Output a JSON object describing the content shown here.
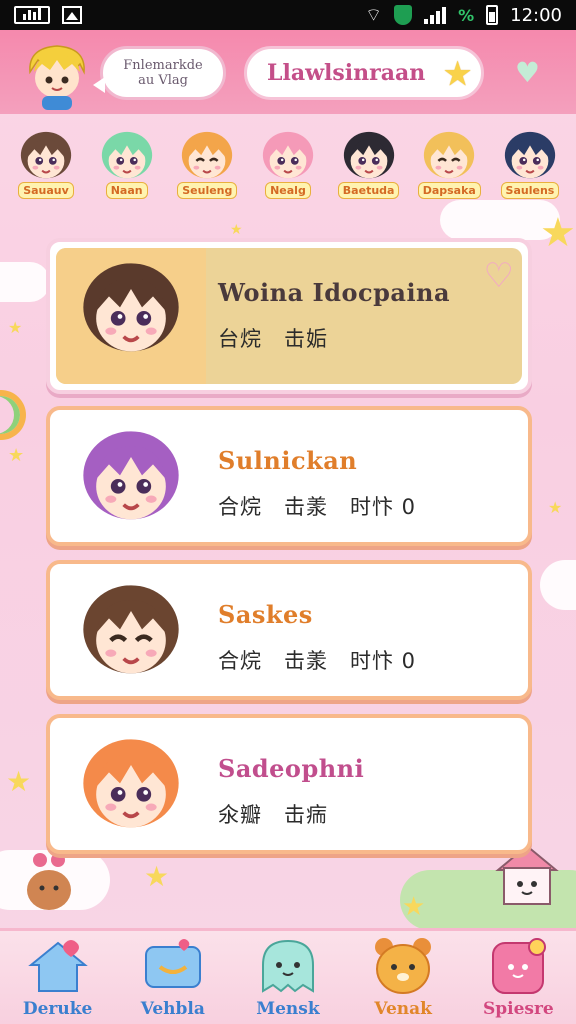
{
  "status_bar": {
    "time": "12:00",
    "battery_pct_icon": "%"
  },
  "header": {
    "speech_bubble": "Fnlemarkde\nau Vlag",
    "title": "Llawlsinraan"
  },
  "characters": [
    {
      "name": "Sauauv",
      "hair": "#6b4a3a"
    },
    {
      "name": "Naan",
      "hair": "#7ad8a8"
    },
    {
      "name": "Seuleng",
      "hair": "#f3a54a"
    },
    {
      "name": "Nealg",
      "hair": "#f59ab8"
    },
    {
      "name": "Baetuda",
      "hair": "#2d2a33"
    },
    {
      "name": "Dapsaka",
      "hair": "#f2c05a"
    },
    {
      "name": "Saulens",
      "hair": "#2b3c66"
    }
  ],
  "cards": [
    {
      "title": "Woina Idocpaina",
      "subtitle": "台烷　击姤",
      "selected": true,
      "hair": "#5a3a2c"
    },
    {
      "title": "Sulnickan",
      "subtitle": "合烷　击羕　时忭 0",
      "selected": false,
      "hair": "#a55fc2"
    },
    {
      "title": "Saskes",
      "subtitle": "合烷　击羕　时忭 0",
      "selected": false,
      "hair": "#6b4530"
    },
    {
      "title": "Sadeophni",
      "subtitle": "氽瓣　击㾍",
      "selected": false,
      "hair": "#f48a4a"
    }
  ],
  "bottom_nav": [
    {
      "label": "Deruke",
      "color": "#3a7fcf",
      "icon": "home-icon"
    },
    {
      "label": "Vehbla",
      "color": "#3a7fcf",
      "icon": "message-icon"
    },
    {
      "label": "Mensk",
      "color": "#3a7fcf",
      "icon": "ghost-icon"
    },
    {
      "label": "Venak",
      "color": "#e1862a",
      "icon": "bear-icon"
    },
    {
      "label": "Spiesre",
      "color": "#d2477f",
      "icon": "profile-icon"
    }
  ]
}
